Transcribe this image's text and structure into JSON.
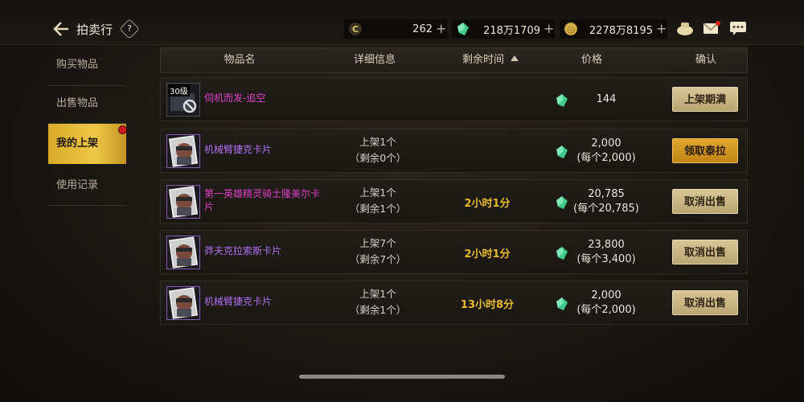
{
  "header": {
    "title": "拍卖行",
    "help": "?"
  },
  "currencies": [
    {
      "icon": "coin-c-icon",
      "value": "262",
      "plus": "+"
    },
    {
      "icon": "green-gem-icon",
      "value": "218万1709",
      "plus": "+"
    },
    {
      "icon": "gold-coin-icon",
      "value": "2278万8195",
      "plus": "+"
    }
  ],
  "sidebar": {
    "items": [
      {
        "label": "购买物品"
      },
      {
        "label": "出售物品"
      },
      {
        "label": "我的上架"
      },
      {
        "label": "使用记录"
      }
    ]
  },
  "table": {
    "headers": [
      "物品名",
      "详细信息",
      "剩余时间",
      "价格",
      "确认"
    ],
    "rows": [
      {
        "level_badge": "30级",
        "name": "伺机而发-追空",
        "name_color": "#e040c8",
        "detail1": "",
        "detail2": "",
        "remain": "",
        "price1": "144",
        "price2": "",
        "button": "上架期满",
        "button_style": "beige"
      },
      {
        "name": "机械臂捷克卡片",
        "name_color": "#b070f0",
        "detail1": "上架1个",
        "detail2": "（剩余0个）",
        "remain": "",
        "price1": "2,000",
        "price2": "(每个2,000)",
        "button": "领取泰拉",
        "button_style": "gold"
      },
      {
        "name": "第一英雄精灵骑士隆美尔卡片",
        "name_color": "#e040c8",
        "detail1": "上架1个",
        "detail2": "（剩余1个）",
        "remain": "2小时1分",
        "price1": "20,785",
        "price2": "(每个20,785)",
        "button": "取消出售",
        "button_style": "beige"
      },
      {
        "name": "莽夫克拉索斯卡片",
        "name_color": "#b070f0",
        "detail1": "上架7个",
        "detail2": "（剩余7个）",
        "remain": "2小时1分",
        "price1": "23,800",
        "price2": "(每个3,400)",
        "button": "取消出售",
        "button_style": "beige"
      },
      {
        "name": "机械臂捷克卡片",
        "name_color": "#b070f0",
        "detail1": "上架1个",
        "detail2": "（剩余1个）",
        "remain": "13小时8分",
        "price1": "2,000",
        "price2": "(每个2,000)",
        "button": "取消出售",
        "button_style": "beige"
      }
    ]
  }
}
